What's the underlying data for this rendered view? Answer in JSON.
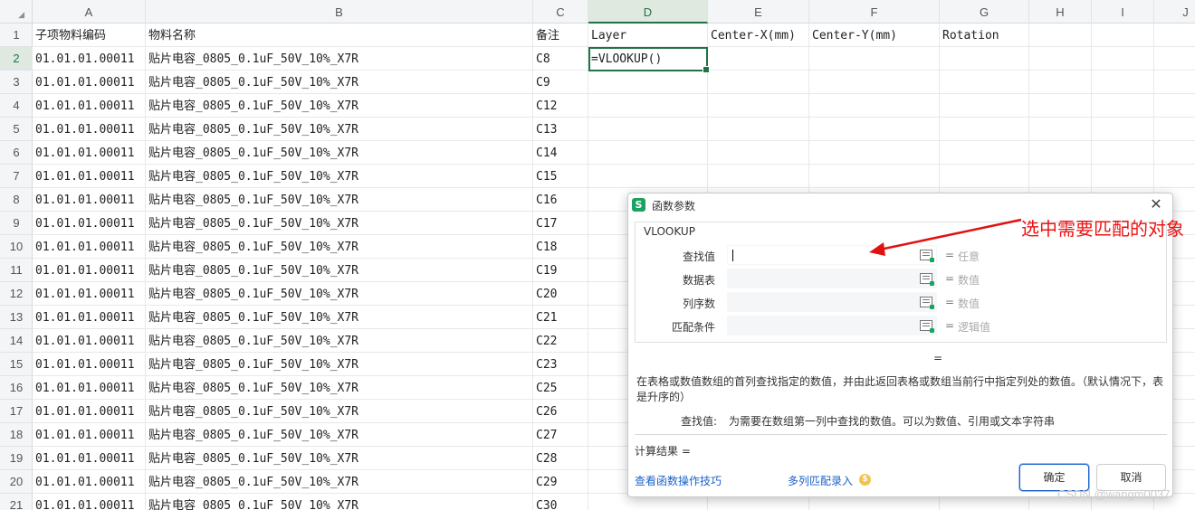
{
  "columns": [
    "A",
    "B",
    "C",
    "D",
    "E",
    "F",
    "G",
    "H",
    "I",
    "J"
  ],
  "selected_column": "D",
  "rows": [
    {
      "n": "1",
      "a": "子项物料编码",
      "b": "物料名称",
      "c": "备注",
      "d": "Layer",
      "e": "Center-X(mm)",
      "f": "Center-Y(mm)",
      "g": "Rotation"
    },
    {
      "n": "2",
      "a": "01.01.01.00011",
      "b": "贴片电容_0805_0.1uF_50V_10%_X7R",
      "c": "C8",
      "d": "=VLOOKUP()"
    },
    {
      "n": "3",
      "a": "01.01.01.00011",
      "b": "贴片电容_0805_0.1uF_50V_10%_X7R",
      "c": "C9"
    },
    {
      "n": "4",
      "a": "01.01.01.00011",
      "b": "贴片电容_0805_0.1uF_50V_10%_X7R",
      "c": "C12"
    },
    {
      "n": "5",
      "a": "01.01.01.00011",
      "b": "贴片电容_0805_0.1uF_50V_10%_X7R",
      "c": "C13"
    },
    {
      "n": "6",
      "a": "01.01.01.00011",
      "b": "贴片电容_0805_0.1uF_50V_10%_X7R",
      "c": "C14"
    },
    {
      "n": "7",
      "a": "01.01.01.00011",
      "b": "贴片电容_0805_0.1uF_50V_10%_X7R",
      "c": "C15"
    },
    {
      "n": "8",
      "a": "01.01.01.00011",
      "b": "贴片电容_0805_0.1uF_50V_10%_X7R",
      "c": "C16"
    },
    {
      "n": "9",
      "a": "01.01.01.00011",
      "b": "贴片电容_0805_0.1uF_50V_10%_X7R",
      "c": "C17"
    },
    {
      "n": "10",
      "a": "01.01.01.00011",
      "b": "贴片电容_0805_0.1uF_50V_10%_X7R",
      "c": "C18"
    },
    {
      "n": "11",
      "a": "01.01.01.00011",
      "b": "贴片电容_0805_0.1uF_50V_10%_X7R",
      "c": "C19"
    },
    {
      "n": "12",
      "a": "01.01.01.00011",
      "b": "贴片电容_0805_0.1uF_50V_10%_X7R",
      "c": "C20"
    },
    {
      "n": "13",
      "a": "01.01.01.00011",
      "b": "贴片电容_0805_0.1uF_50V_10%_X7R",
      "c": "C21"
    },
    {
      "n": "14",
      "a": "01.01.01.00011",
      "b": "贴片电容_0805_0.1uF_50V_10%_X7R",
      "c": "C22"
    },
    {
      "n": "15",
      "a": "01.01.01.00011",
      "b": "贴片电容_0805_0.1uF_50V_10%_X7R",
      "c": "C23"
    },
    {
      "n": "16",
      "a": "01.01.01.00011",
      "b": "贴片电容_0805_0.1uF_50V_10%_X7R",
      "c": "C25"
    },
    {
      "n": "17",
      "a": "01.01.01.00011",
      "b": "贴片电容_0805_0.1uF_50V_10%_X7R",
      "c": "C26"
    },
    {
      "n": "18",
      "a": "01.01.01.00011",
      "b": "贴片电容_0805_0.1uF_50V_10%_X7R",
      "c": "C27"
    },
    {
      "n": "19",
      "a": "01.01.01.00011",
      "b": "贴片电容_0805_0.1uF_50V_10%_X7R",
      "c": "C28"
    },
    {
      "n": "20",
      "a": "01.01.01.00011",
      "b": "贴片电容_0805_0.1uF_50V_10%_X7R",
      "c": "C29"
    },
    {
      "n": "21",
      "a": "01.01.01.00011",
      "b": "贴片电容_0805_0.1uF_50V_10%_X7R",
      "c": "C30"
    }
  ],
  "dialog": {
    "logo": "S",
    "title": "函数参数",
    "function": "VLOOKUP",
    "args": [
      {
        "label": "查找值",
        "value": "",
        "hint": "任意"
      },
      {
        "label": "数据表",
        "value": "",
        "hint": "数值"
      },
      {
        "label": "列序数",
        "value": "",
        "hint": "数值"
      },
      {
        "label": "匹配条件",
        "value": "",
        "hint": "逻辑值"
      }
    ],
    "eq": "=",
    "result_eq": "=",
    "description": "在表格或数值数组的首列查找指定的数值，并由此返回表格或数组当前行中指定列处的数值。（默认情况下，表是升序的）",
    "arg_label": "查找值:",
    "arg_description": "为需要在数组第一列中查找的数值。可以为数值、引用或文本字符串",
    "calc_result": "计算结果 =",
    "tips_link": "查看函数操作技巧",
    "multi_link": "多列匹配录入",
    "coin": "$",
    "ok": "确定",
    "cancel": "取消"
  },
  "annotation": "选中需要匹配的对象",
  "annotation_color": "#e11111",
  "watermark": "CSDN @wangm0037",
  "accent": "#217346"
}
